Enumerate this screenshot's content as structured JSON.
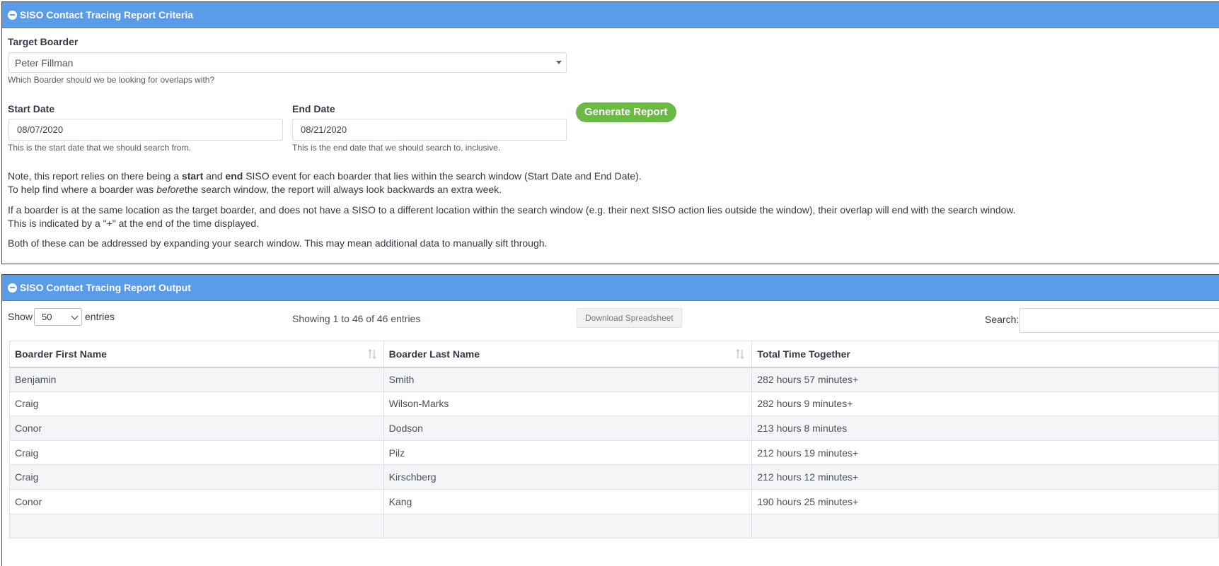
{
  "criteria_panel": {
    "title": "SISO Contact Tracing Report Criteria",
    "target_label": "Target Boarder",
    "target_value": "Peter Fillman",
    "target_help": "Which Boarder should we be looking for overlaps with?",
    "start_label": "Start Date",
    "start_value": "08/07/2020",
    "start_help": "This is the start date that we should search from.",
    "end_label": "End Date",
    "end_value": "08/21/2020",
    "end_help": "This is the end date that we should search to, inclusive.",
    "generate_label": "Generate Report",
    "note1_a": "Note, this report relies on there being a ",
    "note1_b": "start",
    "note1_c": " and ",
    "note1_d": "end",
    "note1_e": " SISO event for each boarder that lies within the search window (Start Date and End Date).",
    "note2_a": "To help find where a boarder was ",
    "note2_b": "before",
    "note2_c": "the search window, the report will always look backwards an extra week.",
    "note3": "If a boarder is at the same location as the target boarder, and does not have a SISO to a different location within the search window (e.g. their next SISO action lies outside the window), their overlap will end with the search window.",
    "note4": "This is indicated by a \"+\" at the end of the time displayed.",
    "note5": "Both of these can be addressed by expanding your search window. This may mean additional data to manually sift through."
  },
  "output_panel": {
    "title": "SISO Contact Tracing Report Output",
    "show_label": "Show",
    "entries_count": "50",
    "entries_label": "entries",
    "info": "Showing 1 to 46 of 46 entries",
    "download_label": "Download Spreadsheet",
    "search_label": "Search:",
    "search_value": ""
  },
  "table": {
    "headers": [
      "Boarder First Name",
      "Boarder Last Name",
      "Total Time Together"
    ],
    "rows": [
      [
        "Benjamin",
        "Smith",
        "282 hours 57 minutes+"
      ],
      [
        "Craig",
        "Wilson-Marks",
        "282 hours 9 minutes+"
      ],
      [
        "Conor",
        "Dodson",
        "213 hours 8 minutes"
      ],
      [
        "Craig",
        "Pilz",
        "212 hours 19 minutes+"
      ],
      [
        "Craig",
        "Kirschberg",
        "212 hours 12 minutes+"
      ],
      [
        "Conor",
        "Kang",
        "190 hours 25 minutes+"
      ],
      [
        "",
        "",
        ""
      ]
    ]
  },
  "colors": {
    "header_bar": "#5b9ce8",
    "generate_button": "#6cba45",
    "stripe": "#f4f5f7"
  }
}
